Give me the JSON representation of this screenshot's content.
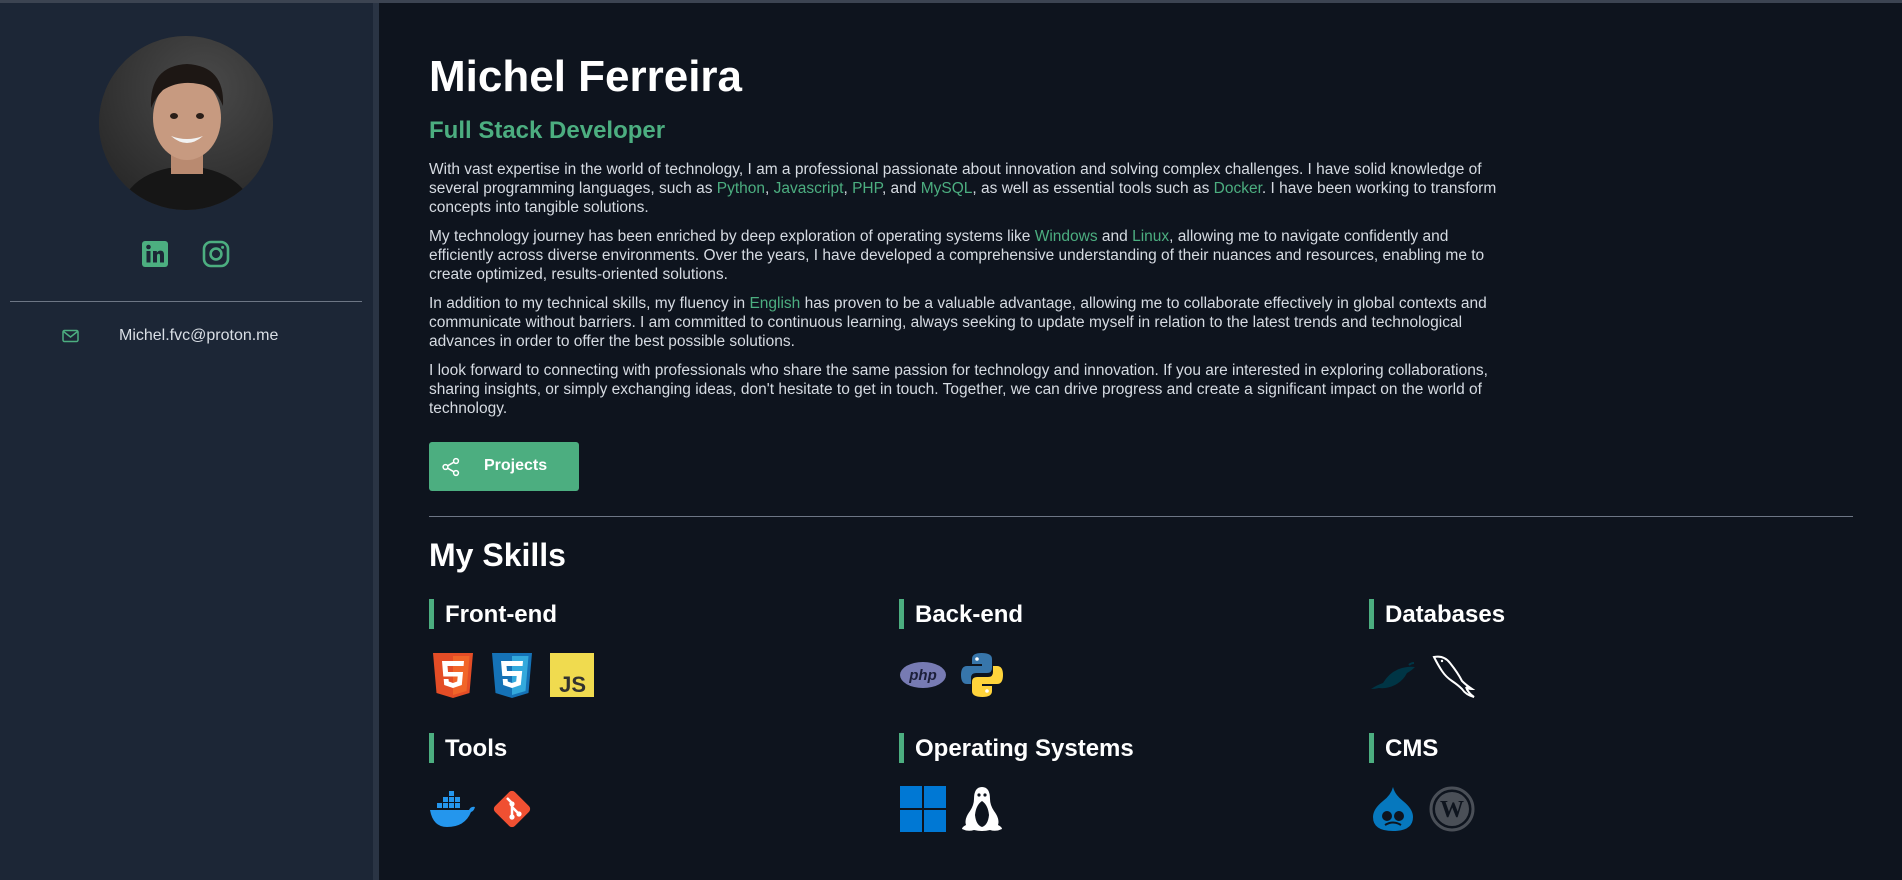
{
  "profile": {
    "name": "Michel Ferreira",
    "role": "Full Stack Developer",
    "email": "Michel.fvc@proton.me"
  },
  "bio": [
    [
      {
        "t": "With vast expertise in the world of technology, I am a professional passionate about innovation and solving complex challenges. I have solid knowledge of several programming languages, such as "
      },
      {
        "t": "Python",
        "hl": true
      },
      {
        "t": ", "
      },
      {
        "t": "Javascript",
        "hl": true
      },
      {
        "t": ", "
      },
      {
        "t": "PHP",
        "hl": true
      },
      {
        "t": ", and "
      },
      {
        "t": "MySQL",
        "hl": true
      },
      {
        "t": ", as well as essential tools such as "
      },
      {
        "t": "Docker",
        "hl": true
      },
      {
        "t": ". I have been working to transform concepts into tangible solutions."
      }
    ],
    [
      {
        "t": "My technology journey has been enriched by deep exploration of operating systems like "
      },
      {
        "t": "Windows",
        "hl": true
      },
      {
        "t": " and "
      },
      {
        "t": "Linux",
        "hl": true
      },
      {
        "t": ", allowing me to navigate confidently and efficiently across diverse environments. Over the years, I have developed a comprehensive understanding of their nuances and resources, enabling me to create optimized, results-oriented solutions."
      }
    ],
    [
      {
        "t": "In addition to my technical skills, my fluency in "
      },
      {
        "t": "English",
        "hl": true
      },
      {
        "t": " has proven to be a valuable advantage, allowing me to collaborate effectively in global contexts and communicate without barriers. I am committed to continuous learning, always seeking to update myself in relation to the latest trends and technological advances in order to offer the best possible solutions."
      }
    ],
    [
      {
        "t": "I look forward to connecting with professionals who share the same passion for technology and innovation. If you are interested in exploring collaborations, sharing insights, or simply exchanging ideas, don't hesitate to get in touch. Together, we can drive progress and create a significant impact on the world of technology."
      }
    ]
  ],
  "projects_button": {
    "label": "Projects",
    "icon": "share-icon"
  },
  "skills": {
    "title": "My Skills",
    "groups": [
      {
        "name": "Front-end",
        "icons": [
          "html5-icon",
          "css3-icon",
          "javascript-icon"
        ]
      },
      {
        "name": "Back-end",
        "icons": [
          "php-icon",
          "python-icon"
        ]
      },
      {
        "name": "Databases",
        "icons": [
          "mariadb-icon",
          "mysql-icon"
        ]
      },
      {
        "name": "Tools",
        "icons": [
          "docker-icon",
          "git-icon"
        ]
      },
      {
        "name": "Operating Systems",
        "icons": [
          "windows-icon",
          "linux-icon"
        ]
      },
      {
        "name": "CMS",
        "icons": [
          "drupal-icon",
          "wordpress-icon"
        ]
      }
    ]
  },
  "social": [
    "linkedin-icon",
    "instagram-icon"
  ],
  "colors": {
    "accent": "#4cae80",
    "background": "#0e141e",
    "sidebar": "#1c2636"
  }
}
